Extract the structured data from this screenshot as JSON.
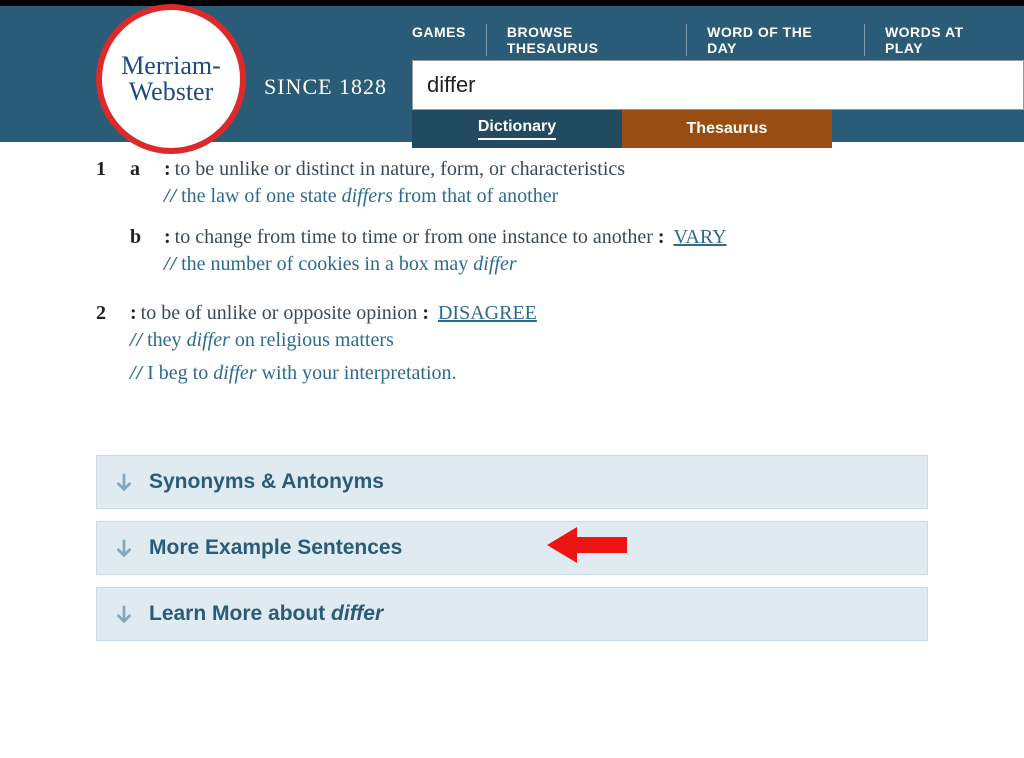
{
  "header": {
    "logo_line1": "Merriam-",
    "logo_line2": "Webster",
    "since": "SINCE 1828",
    "nav": [
      "GAMES",
      "BROWSE THESAURUS",
      "WORD OF THE DAY",
      "WORDS AT PLAY"
    ],
    "search_value": "differ",
    "tabs": {
      "dictionary": "Dictionary",
      "thesaurus": "Thesaurus"
    }
  },
  "entry": {
    "senses": [
      {
        "num": "1",
        "subs": [
          {
            "let": "a",
            "def": "to be unlike or distinct in nature, form, or characteristics",
            "ex_pre": "the law of one state ",
            "ex_em": "differs",
            "ex_post": " from that of another"
          },
          {
            "let": "b",
            "def": "to change from time to time or from one instance to another ",
            "link": "VARY",
            "ex_pre": "the number of cookies in a box may ",
            "ex_em": "differ",
            "ex_post": ""
          }
        ]
      },
      {
        "num": "2",
        "subs": [
          {
            "let": "",
            "def": "to be of unlike or opposite opinion ",
            "link": "DISAGREE",
            "ex_pre": "they ",
            "ex_em": "differ",
            "ex_post": " on religious matters",
            "ex2_pre": "I beg to ",
            "ex2_em": "differ",
            "ex2_post": " with your interpretation."
          }
        ]
      }
    ]
  },
  "expanders": {
    "syn": "Synonyms & Antonyms",
    "more": "More Example Sentences",
    "learn_pre": "Learn More about ",
    "learn_em": "differ"
  }
}
